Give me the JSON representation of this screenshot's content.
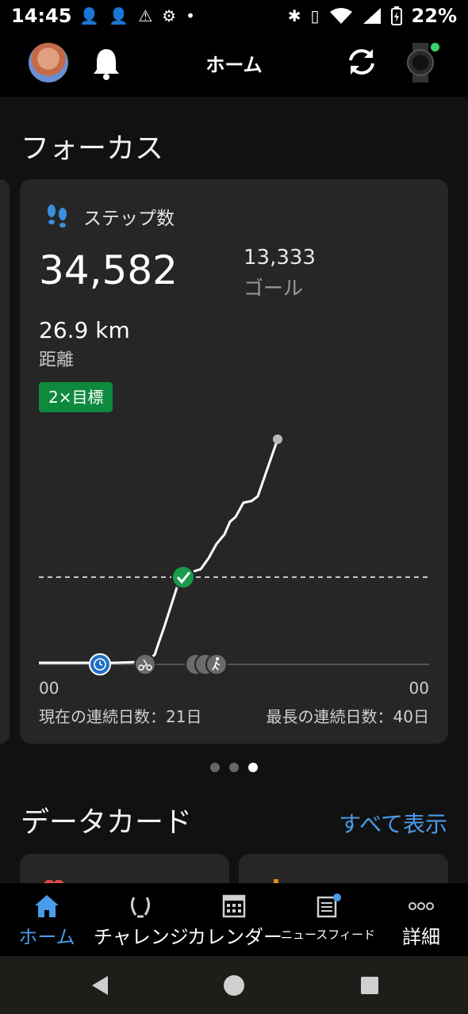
{
  "status_bar": {
    "time": "14:45",
    "battery": "22%",
    "icons": [
      "person-add-icon",
      "person-add-icon",
      "alert-icon",
      "gears-icon",
      "dot-icon",
      "bluetooth-icon",
      "vibrate-icon",
      "wifi-icon",
      "signal-icon",
      "battery-charging-icon"
    ]
  },
  "header": {
    "title": "ホーム"
  },
  "focus": {
    "title": "フォーカス",
    "card": {
      "title": "ステップ数",
      "steps": "34,582",
      "goal_value": "13,333",
      "goal_label": "ゴール",
      "distance_value": "26.9 km",
      "distance_label": "距離",
      "badge": "2×目標",
      "tick_left": "00",
      "tick_right": "00",
      "streak_current": "現在の連続日数：21日",
      "streak_longest": "最長の連続日数：40日",
      "goal_reached": 0.56,
      "activity_icons": [
        "timer-icon",
        "cycling-icon",
        "walking-icon",
        "walking-icon",
        "walking-icon"
      ]
    },
    "pager": {
      "count": 3,
      "active": 2
    }
  },
  "data_cards": {
    "title": "データカード",
    "see_all": "すべて表示"
  },
  "tabs": [
    {
      "label": "ホーム",
      "icon": "home-icon",
      "active": true
    },
    {
      "label": "チャレンジ",
      "icon": "laurel-icon",
      "active": false
    },
    {
      "label": "カレンダー",
      "icon": "calendar-icon",
      "active": false
    },
    {
      "label": "ニュースフィード",
      "icon": "newsfeed-icon",
      "active": false
    },
    {
      "label": "詳細",
      "icon": "more-icon",
      "active": false
    }
  ],
  "colors": {
    "accent": "#4a9be8",
    "badge": "#0e8a3e",
    "check": "#1a9a4a",
    "timer": "#1f6fc7",
    "card": "#262626"
  }
}
